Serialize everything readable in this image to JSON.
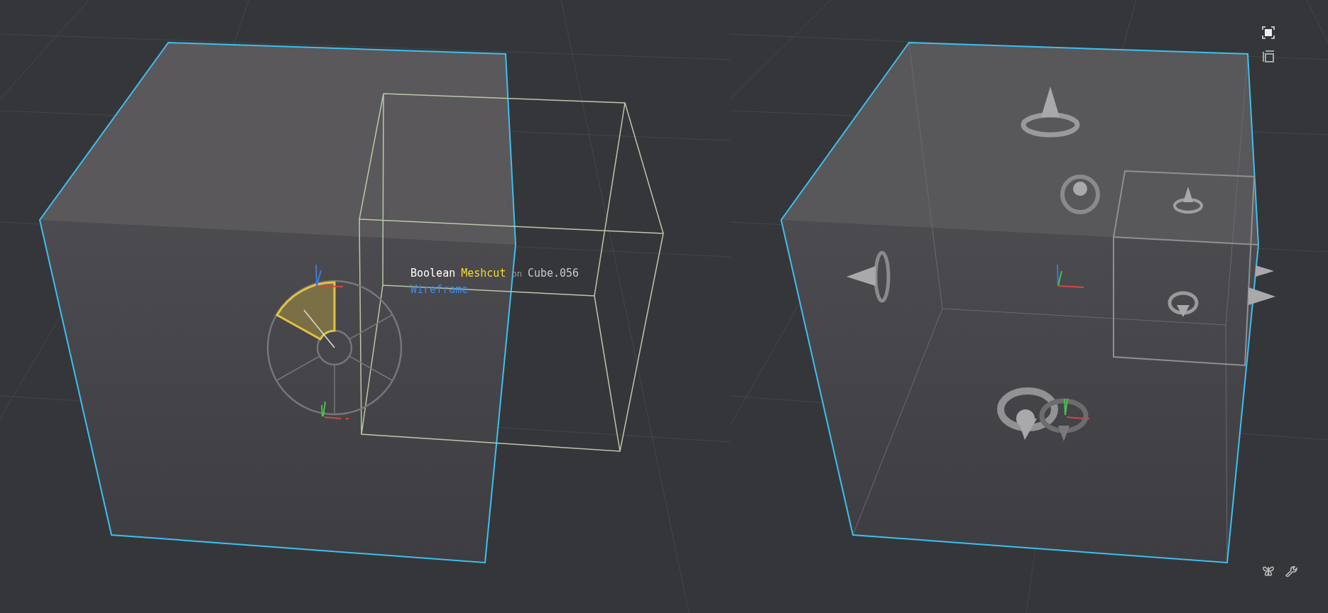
{
  "viewport_label": {
    "words": [
      {
        "text": "Boolean",
        "kind": "name"
      },
      {
        "text": "Meshcut",
        "kind": "highlight"
      },
      {
        "text": "on",
        "kind": "connector"
      },
      {
        "text": "Cube.056",
        "kind": "object"
      }
    ],
    "mode": "Wireframe"
  }
}
